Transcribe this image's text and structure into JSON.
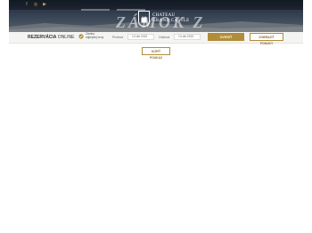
{
  "hero": {
    "logo_line1": "CHATEAU",
    "logo_line2": "GRAND CASTLE",
    "watermark": "ZÁMOK Z",
    "social": [
      "f",
      "◎",
      "▶"
    ],
    "accent": "#c8a64a"
  },
  "booking": {
    "title_bold": "REZERVÁCIA",
    "title_rest": " ONLINE",
    "best_price_line1": "Záruka",
    "best_price_line2": "najlepšej ceny",
    "arrival_label": "Príchod",
    "arrival_value": "13 okt 2022",
    "departure_label": "Odchod",
    "departure_value": "14 okt 2022",
    "check_availability": "OVERIŤ DOSTUPNOSŤ",
    "offers": "ZOBRAZIŤ PONUKY",
    "voucher": "KÚPIŤ POUKAZ",
    "accent": "#b08d3a"
  }
}
